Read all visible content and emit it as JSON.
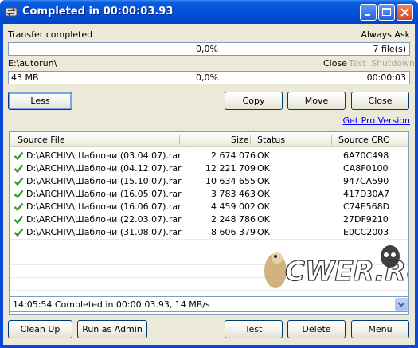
{
  "window": {
    "title": "Completed in 00:00:03.93"
  },
  "transfer": {
    "status_label": "Transfer completed",
    "always_ask_label": "Always Ask",
    "progress_percent": "0,0%",
    "files_count": "7 file(s)",
    "path": "E:\\autorun\\",
    "close_label": "Close",
    "test_label": "Test",
    "shutdown_label": "Shutdown",
    "size": "43 MB",
    "file_progress_percent": "0,0%",
    "elapsed": "00:00:03"
  },
  "buttons": {
    "less": "Less",
    "copy": "Copy",
    "move": "Move",
    "close": "Close",
    "get_pro": "Get Pro Version",
    "clean_up": "Clean Up",
    "run_as_admin": "Run as Admin",
    "test": "Test",
    "delete": "Delete",
    "menu": "Menu"
  },
  "table": {
    "columns": [
      "Source File",
      "Size",
      "Status",
      "Source CRC"
    ],
    "rows": [
      {
        "file": "D:\\ARCHIV\\Шаблони (03.04.07).rar",
        "size": "2 674 076",
        "status": "OK",
        "crc": "6A70C498"
      },
      {
        "file": "D:\\ARCHIV\\Шаблони (04.12.07).rar",
        "size": "12 221 709",
        "status": "OK",
        "crc": "CA8F0100"
      },
      {
        "file": "D:\\ARCHIV\\Шаблони (15.10.07).rar",
        "size": "10 634 655",
        "status": "OK",
        "crc": "947CA590"
      },
      {
        "file": "D:\\ARCHIV\\Шаблони (16.05.07).rar",
        "size": "3 783 463",
        "status": "OK",
        "crc": "417D30A7"
      },
      {
        "file": "D:\\ARCHIV\\Шаблони (16.06.07).rar",
        "size": "4 459 002",
        "status": "OK",
        "crc": "C74E568D"
      },
      {
        "file": "D:\\ARCHIV\\Шаблони (22.03.07).rar",
        "size": "2 248 786",
        "status": "OK",
        "crc": "27DF9210"
      },
      {
        "file": "D:\\ARCHIV\\Шаблони (31.08.07).rar",
        "size": "8 606 379",
        "status": "OK",
        "crc": "E0CC2003"
      }
    ]
  },
  "log": {
    "selected": "14:05:54 Completed in 00:00:03.93, 14 MB/s"
  },
  "watermark": {
    "text": "CWER.RU"
  },
  "colors": {
    "titlebar": "#0552d9",
    "client": "#ece9d8",
    "checkmark": "#2e9a2e",
    "link": "#0000ff"
  }
}
